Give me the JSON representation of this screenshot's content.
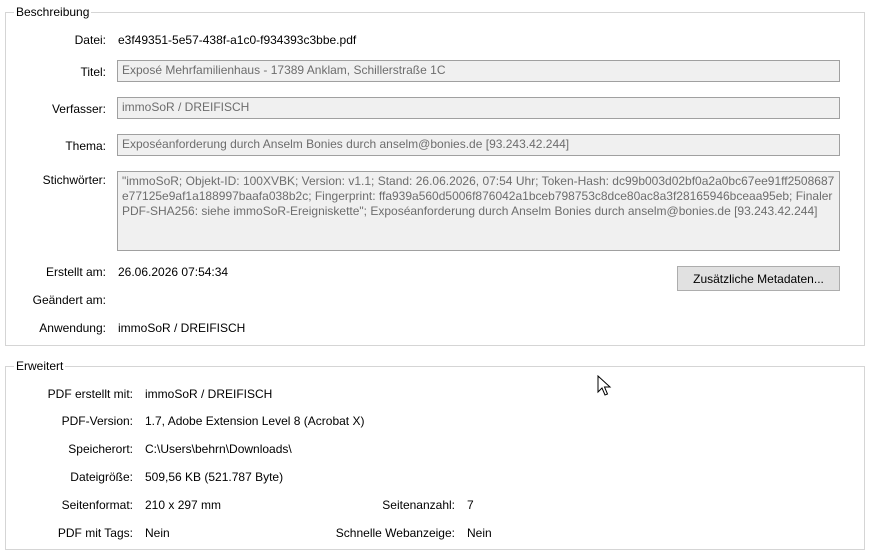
{
  "description": {
    "legend": "Beschreibung",
    "file_label": "Datei:",
    "file_value": "e3f49351-5e57-438f-a1c0-f934393c3bbe.pdf",
    "title_label": "Titel:",
    "title_value": "Exposé Mehrfamilienhaus - 17389 Anklam, Schillerstraße 1C",
    "author_label": "Verfasser:",
    "author_value": "immoSoR / DREIFISCH",
    "subject_label": "Thema:",
    "subject_value": "Exposéanforderung durch Anselm Bonies durch anselm@bonies.de [93.243.42.244]",
    "keywords_label": "Stichwörter:",
    "keywords_value": "\"immoSoR; Objekt-ID: 100XVBK; Version: v1.1; Stand: 26.06.2026, 07:54 Uhr; Token-Hash: dc99b003d02bf0a2a0bc67ee91ff2508687e77125e9af1a188997baafa038b2c; Fingerprint: ffa939a560d5006f876042a1bceb798753c8dce80ac8a3f28165946bceaa95eb; Finaler PDF-SHA256: siehe immoSoR-Ereigniskette\"; Exposéanforderung durch Anselm Bonies durch anselm@bonies.de [93.243.42.244]",
    "created_label": "Erstellt am:",
    "created_value": "26.06.2026 07:54:34",
    "modified_label": "Geändert am:",
    "modified_value": "",
    "application_label": "Anwendung:",
    "application_value": "immoSoR / DREIFISCH",
    "more_metadata_button": "Zusätzliche Metadaten..."
  },
  "advanced": {
    "legend": "Erweitert",
    "producer_label": "PDF erstellt mit:",
    "producer_value": "immoSoR / DREIFISCH",
    "version_label": "PDF-Version:",
    "version_value": "1.7, Adobe Extension Level 8 (Acrobat X)",
    "location_label": "Speicherort:",
    "location_value": "C:\\Users\\behrn\\Downloads\\",
    "filesize_label": "Dateigröße:",
    "filesize_value": "509,56 KB (521.787 Byte)",
    "pagesize_label": "Seitenformat:",
    "pagesize_value": "210 x 297 mm",
    "pagecount_label": "Seitenanzahl:",
    "pagecount_value": "7",
    "tagged_label": "PDF mit Tags:",
    "tagged_value": "Nein",
    "fastweb_label": "Schnelle Webanzeige:",
    "fastweb_value": "Nein"
  }
}
